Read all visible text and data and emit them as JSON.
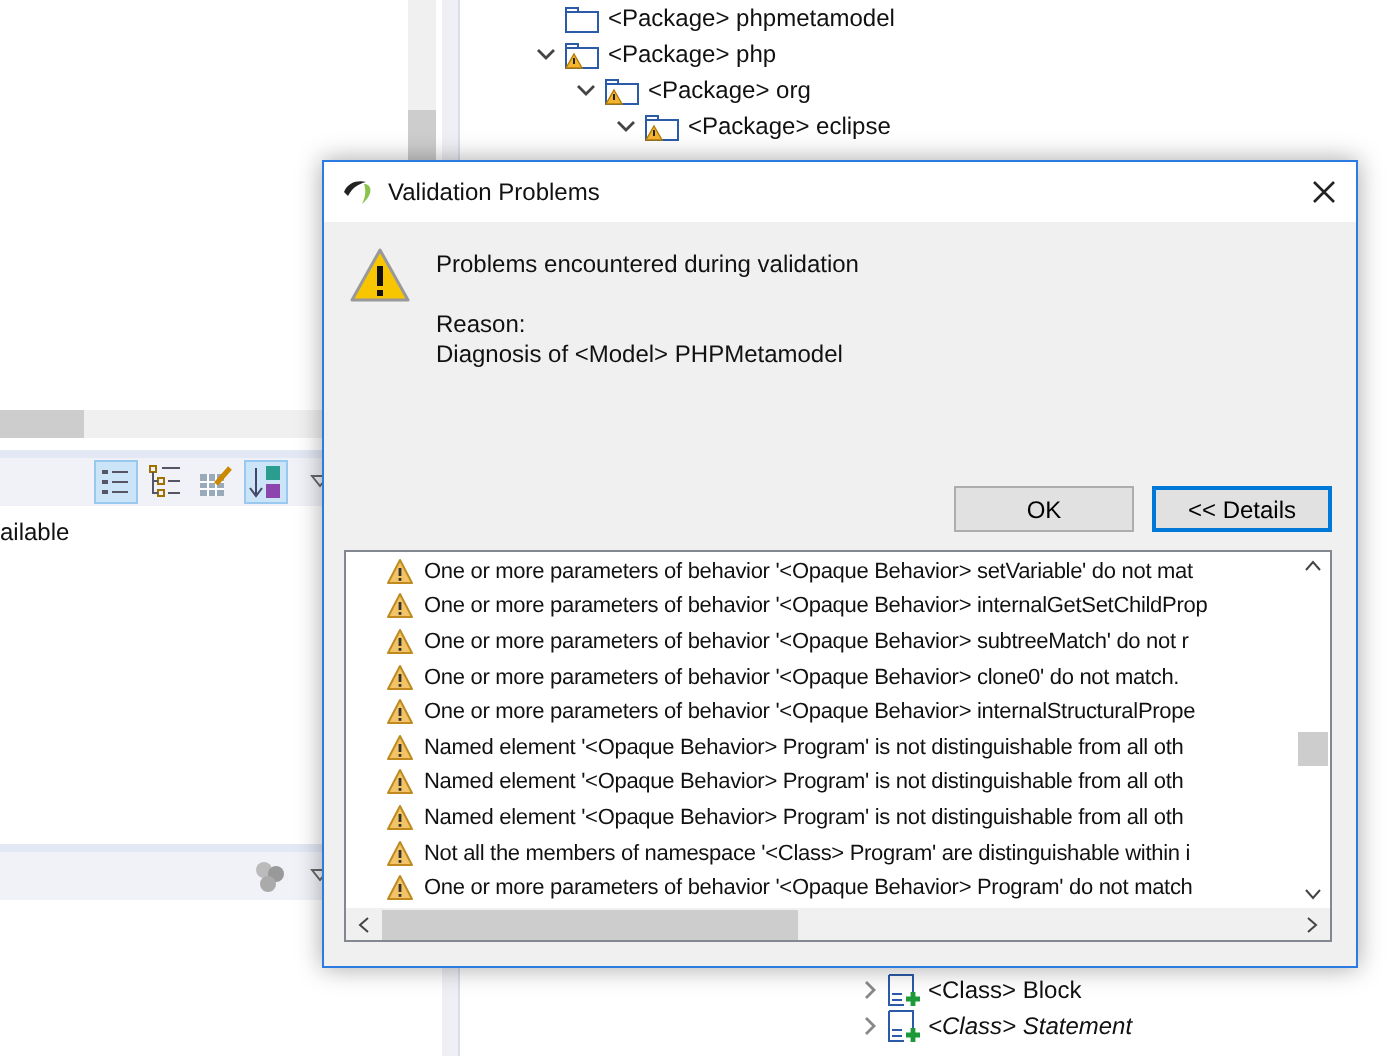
{
  "tree_top": [
    {
      "label": "<Package> phpmetamodel",
      "warning": false
    },
    {
      "label": "<Package> php",
      "warning": true,
      "expanded": true,
      "children": [
        {
          "label": "<Package> org",
          "warning": true,
          "expanded": true,
          "children": [
            {
              "label": "<Package> eclipse",
              "warning": true,
              "expanded": true
            }
          ]
        }
      ]
    }
  ],
  "tree_bottom": [
    {
      "label": "<Class> Block",
      "abstract": false,
      "expanded": false
    },
    {
      "label": "<Class> Statement",
      "abstract": true,
      "expanded": false
    }
  ],
  "left_panel": {
    "toolbar": [
      {
        "kind": "list",
        "on": true
      },
      {
        "kind": "tree",
        "on": false
      },
      {
        "kind": "table",
        "on": false
      },
      {
        "kind": "sort",
        "on": true
      }
    ],
    "text": "ailable"
  },
  "dialog": {
    "title": "Validation Problems",
    "message": "Problems encountered during validation",
    "reason_label": "Reason:",
    "reason": "Diagnosis of <Model> PHPMetamodel",
    "buttons": [
      {
        "label": "OK",
        "focused": false
      },
      {
        "label": "<< Details",
        "focused": true
      }
    ],
    "details": [
      "One or more parameters of behavior '<Opaque Behavior> setVariable' do not mat",
      "One or more parameters of behavior '<Opaque Behavior> internalGetSetChildProp",
      "One or more parameters of behavior '<Opaque Behavior> subtreeMatch' do not r",
      "One or more parameters of behavior '<Opaque Behavior> clone0' do not match.",
      "One or more parameters of behavior '<Opaque Behavior> internalStructuralPrope",
      "Named element '<Opaque Behavior> Program' is not distinguishable from all oth",
      "Named element '<Opaque Behavior> Program' is not distinguishable from all oth",
      "Named element '<Opaque Behavior> Program' is not distinguishable from all oth",
      "Not all the members of namespace '<Class> Program' are distinguishable within i",
      "One or more parameters of behavior '<Opaque Behavior> Program' do not match"
    ]
  }
}
